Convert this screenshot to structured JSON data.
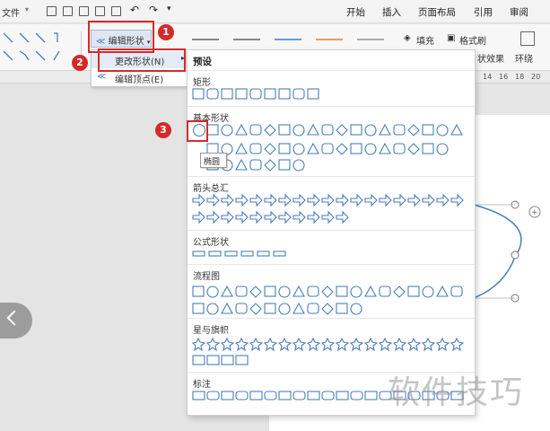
{
  "menubar": {
    "file_label": "文件",
    "tabs": [
      "开始",
      "插入",
      "页面布局",
      "引用",
      "审阅"
    ]
  },
  "ribbon": {
    "edit_shape_label": "编辑形状",
    "fill_label": "填充",
    "format_brush_label": "格式刷",
    "effect_label": "状效果",
    "wrap_label": "环绕"
  },
  "ruler": {
    "numbers": [
      "14",
      "16",
      "18",
      "20"
    ]
  },
  "submenu": {
    "change_shape": "更改形状(N)",
    "edit_points": "编辑顶点(E)"
  },
  "panel": {
    "preset": "预设",
    "sections": [
      "矩形",
      "基本形状",
      "箭头总汇",
      "公式形状",
      "流程图",
      "星与旗帜",
      "标注"
    ]
  },
  "tooltip": "椭圆",
  "badges": [
    "1",
    "2",
    "3"
  ],
  "watermark": "软件技巧",
  "colors": {
    "accent": "#d42a2a",
    "shape_stroke": "#4a7db8"
  }
}
